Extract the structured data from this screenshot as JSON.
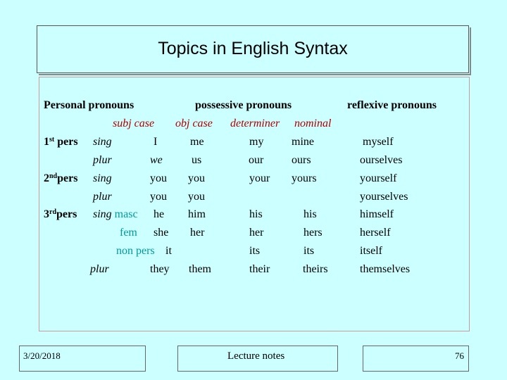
{
  "slide": {
    "title": "Topics in English Syntax",
    "footer": {
      "date": "3/20/2018",
      "center": "Lecture notes",
      "page": "76"
    }
  },
  "headers": {
    "personal": "Personal pronouns",
    "possessive": "possessive pronouns",
    "reflexive": "reflexive pronouns",
    "subj_case": "subj case",
    "obj_case": "obj case",
    "determiner": "determiner",
    "nominal": "nominal"
  },
  "persons": {
    "first": {
      "num": "1",
      "sup": "st",
      "word": "pers"
    },
    "second": {
      "num": "2",
      "sup": "nd",
      "word": "pers"
    },
    "third": {
      "num": "3",
      "sup": "rd",
      "word": "pers"
    }
  },
  "numbers": {
    "sing": "sing",
    "plur": "plur"
  },
  "genders": {
    "masc": "masc",
    "fem": "fem",
    "non_pers": "non pers"
  },
  "rows": {
    "first_sing": {
      "subj": "I",
      "obj": "me",
      "det": "my",
      "nom": "mine",
      "refl": "myself"
    },
    "first_plur": {
      "subj": "we",
      "obj": "us",
      "det": "our",
      "nom": "ours",
      "refl": "ourselves"
    },
    "second_sing": {
      "subj": "you",
      "obj": "you",
      "det": "your",
      "nom": "yours",
      "refl": "yourself"
    },
    "second_plur": {
      "subj": "you",
      "obj": "you",
      "refl": "yourselves"
    },
    "third_masc": {
      "subj": "he",
      "obj": "him",
      "det": "his",
      "nom": "his",
      "refl": "himself"
    },
    "third_fem": {
      "subj": "she",
      "obj": "her",
      "det": "her",
      "nom": "hers",
      "refl": "herself"
    },
    "third_nonpers": {
      "subj": "it",
      "det": "its",
      "nom": "its",
      "refl": "itself"
    },
    "third_plur": {
      "subj": "they",
      "obj": "them",
      "det": "their",
      "nom": "theirs",
      "refl": "themselves"
    }
  }
}
